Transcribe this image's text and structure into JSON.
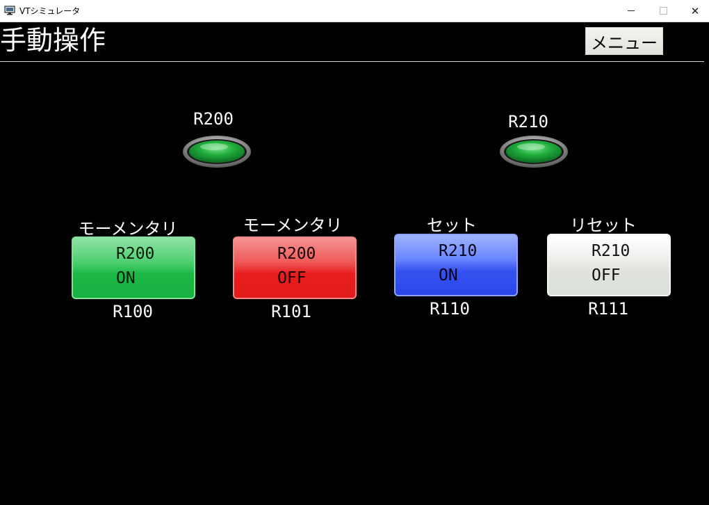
{
  "window": {
    "title": "VTシミュレータ",
    "minimize_glyph": "",
    "close_glyph": "✕"
  },
  "header": {
    "title": "手動操作",
    "menu_label": "メニュー"
  },
  "lamps": [
    {
      "label": "R200",
      "color": "#1aa83a"
    },
    {
      "label": "R210",
      "color": "#1aa83a"
    }
  ],
  "buttons": [
    {
      "caption": "モーメンタリ",
      "line1": "R200",
      "line2": "ON",
      "address": "R100",
      "color": "#1cb846"
    },
    {
      "caption": "モーメンタリ",
      "line1": "R200",
      "line2": "OFF",
      "address": "R101",
      "color": "#e81e1e"
    },
    {
      "caption": "セット",
      "line1": "R210",
      "line2": "ON",
      "address": "R110",
      "color": "#3552f0"
    },
    {
      "caption": "リセット",
      "line1": "R210",
      "line2": "OFF",
      "address": "R111",
      "color": "#dfe3dc"
    }
  ]
}
